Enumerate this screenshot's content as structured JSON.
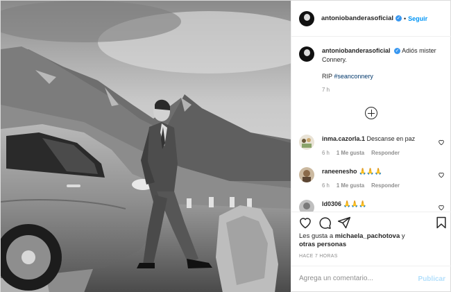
{
  "post": {
    "username": "antoniobanderasoficial",
    "follow_separator": "•",
    "follow_label": "Seguir"
  },
  "caption": {
    "username": "antoniobanderasoficial",
    "text": "Adiós mister Connery.",
    "rip": "RIP",
    "hashtag": "#seanconnery",
    "time": "7 h"
  },
  "comments": [
    {
      "username": "inma.cazorla.1",
      "text": "Descanse en paz",
      "time": "6 h",
      "likes": "1 Me gusta",
      "reply": "Responder"
    },
    {
      "username": "raneenesho",
      "text": "🙏🙏🙏",
      "time": "6 h",
      "likes": "1 Me gusta",
      "reply": "Responder"
    },
    {
      "username": "ld0306",
      "text": "🙏🙏🙏",
      "time": "",
      "likes": "",
      "reply": ""
    }
  ],
  "likes": {
    "prefix": "Les gusta a",
    "user": "michaela_pachotova",
    "middle": "y",
    "others": "otras personas"
  },
  "timestamp": "HACE 7 HORAS",
  "add_comment": {
    "placeholder": "Agrega un comentario...",
    "publish_label": "Publicar"
  },
  "icons": {
    "verified": "verified-badge-icon",
    "load_more": "plus-circle-icon",
    "like": "heart-icon",
    "comment": "comment-bubble-icon",
    "share": "paper-plane-icon",
    "save": "bookmark-icon"
  },
  "colors": {
    "link_blue": "#0095f6",
    "verified_blue": "#3897f0",
    "muted": "#8e8e8e",
    "publish_disabled": "#b2dffc"
  }
}
